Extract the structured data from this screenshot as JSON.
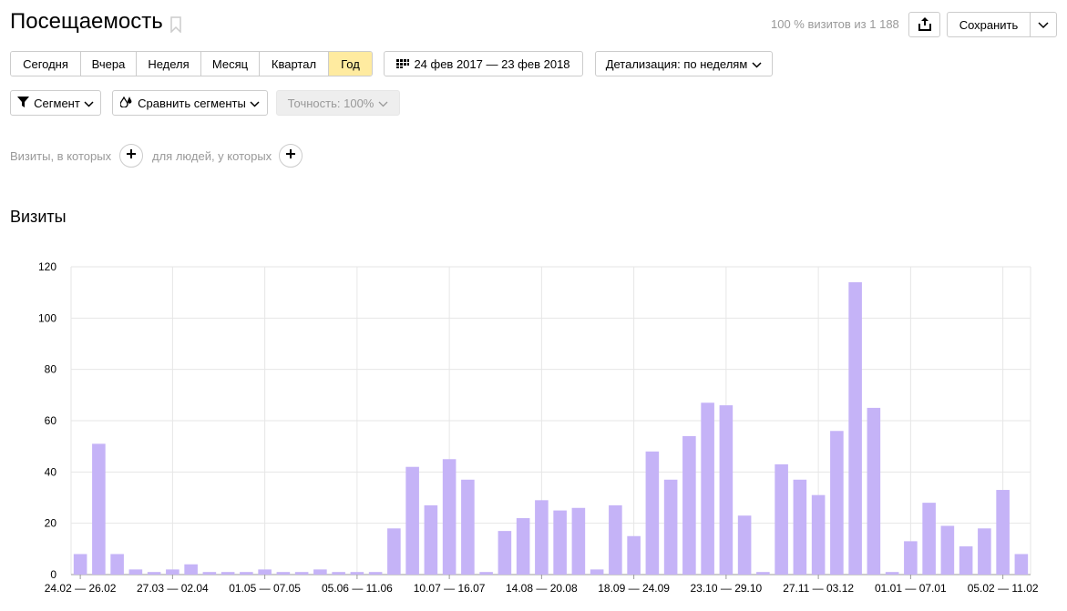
{
  "header": {
    "title": "Посещаемость",
    "summary": "100 % визитов из 1 188",
    "save_label": "Сохранить"
  },
  "toolbar": {
    "periods": [
      {
        "label": "Сегодня",
        "active": false
      },
      {
        "label": "Вчера",
        "active": false
      },
      {
        "label": "Неделя",
        "active": false
      },
      {
        "label": "Месяц",
        "active": false
      },
      {
        "label": "Квартал",
        "active": false
      },
      {
        "label": "Год",
        "active": true
      }
    ],
    "date_range": "24 фев 2017 — 23 фев 2018",
    "detail": "Детализация: по неделям",
    "segment": "Сегмент",
    "compare": "Сравнить сегменты",
    "accuracy": "Точность: 100%"
  },
  "filters": {
    "visits_label": "Визиты, в которых",
    "people_label": "для людей, у которых"
  },
  "section_title": "Визиты",
  "colors": {
    "bar": "#c5b3f7",
    "active_tab": "#ffeba0",
    "grid": "#e6e6e6"
  },
  "icons": [
    "bookmark-icon",
    "share-icon",
    "chevron-down-icon",
    "calendar-icon",
    "filter-icon",
    "compare-icon",
    "plus-icon"
  ],
  "chart_data": {
    "type": "bar",
    "ylim": [
      0,
      120
    ],
    "yticks": [
      0,
      20,
      40,
      60,
      80,
      100,
      120
    ],
    "grid": true,
    "xtick_labels": [
      {
        "index": 0,
        "label": "24.02 — 26.02"
      },
      {
        "index": 5,
        "label": "27.03 — 02.04"
      },
      {
        "index": 10,
        "label": "01.05 — 07.05"
      },
      {
        "index": 15,
        "label": "05.06 — 11.06"
      },
      {
        "index": 20,
        "label": "10.07 — 16.07"
      },
      {
        "index": 25,
        "label": "14.08 — 20.08"
      },
      {
        "index": 30,
        "label": "18.09 — 24.09"
      },
      {
        "index": 35,
        "label": "23.10 — 29.10"
      },
      {
        "index": 40,
        "label": "27.11 — 03.12"
      },
      {
        "index": 45,
        "label": "01.01 — 07.01"
      },
      {
        "index": 50,
        "label": "05.02 — 11.02"
      }
    ],
    "values": [
      8,
      51,
      8,
      2,
      1,
      2,
      4,
      1,
      1,
      1,
      2,
      1,
      1,
      2,
      1,
      1,
      1,
      18,
      42,
      27,
      45,
      37,
      1,
      17,
      22,
      29,
      25,
      26,
      2,
      27,
      15,
      48,
      37,
      54,
      67,
      66,
      23,
      1,
      43,
      37,
      31,
      56,
      114,
      65,
      1,
      13,
      28,
      19,
      11,
      18,
      33,
      8
    ]
  }
}
